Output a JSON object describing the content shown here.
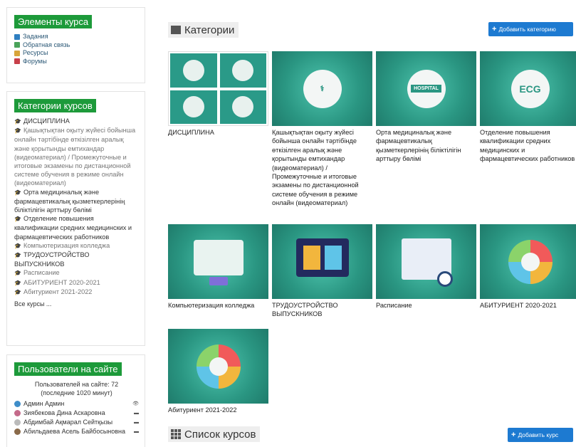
{
  "sidebar": {
    "elements": {
      "title": "Элементы курса",
      "items": [
        "Задания",
        "Обратная связь",
        "Ресурсы",
        "Форумы"
      ]
    },
    "categories": {
      "title": "Категории курсов",
      "items": [
        "ДИСЦИПЛИНА",
        "Қашықтықтан оқыту жүйесі бойынша онлайн тәртібінде өткізілген аралық және қорытынды емтихандар (видеоматериал) / Промежуточные и итоговые экзамены по дистанционной системе обучения в режиме онлайн (видеоматериал)",
        "Орта медициналық және фармацевтикалық қызметкерлерінің біліктілігін арттыру бөлімі",
        "Отделение повышения квалификации средних медицинских и фармацевтических работников",
        "Компьютеризация колледжа",
        "ТРУДОУСТРОЙСТВО ВЫПУСКНИКОВ",
        "Расписание",
        "АБИТУРИЕНТ 2020-2021",
        "Абитуриент 2021-2022"
      ],
      "all_courses": "Все курсы ..."
    },
    "users": {
      "title": "Пользователи на сайте",
      "summary_line1": "Пользователей на сайте: 72",
      "summary_line2": "(последние 1020 минут)",
      "list": [
        "Админ Админ",
        "Зиябекова Дина Аскаровна",
        "Абдимбай Ақмарал Сейтқызы",
        "Абильдаева Асель Байбосыновна"
      ]
    }
  },
  "main": {
    "categories_heading": "Категории",
    "add_category_label": "Добавить категорию",
    "course_list_heading": "Список курсов",
    "add_course_label": "Добавить курс",
    "cards": [
      "ДИСЦИПЛИНА",
      "Қашықтықтан оқыту жүйесі бойынша онлайн тәртібінде өткізілген аралық және қорытынды емтихандар (видеоматериал) / Промежуточные и итоговые экзамены по дистанционной системе обучения в режиме онлайн (видеоматериал)",
      "Орта медициналық және фармацевтикалық қызметкерлерінің біліктілігін арттыру бөлімі",
      "Отделение повышения квалификации средних медицинских и фармацевтических работников",
      "Компьютеризация колледжа",
      "ТРУДОУСТРОЙСТВО ВЫПУСКНИКОВ",
      "Расписание",
      "АБИТУРИЕНТ 2020-2021",
      "Абитуриент 2021-2022"
    ],
    "card_image_labels": {
      "hospital": "HOSPITAL",
      "ecg": "ECG"
    }
  },
  "colors": {
    "accent": "#1d7ad1",
    "block_title": "#1d9a3a",
    "card_teal": "#2f9c8a"
  }
}
